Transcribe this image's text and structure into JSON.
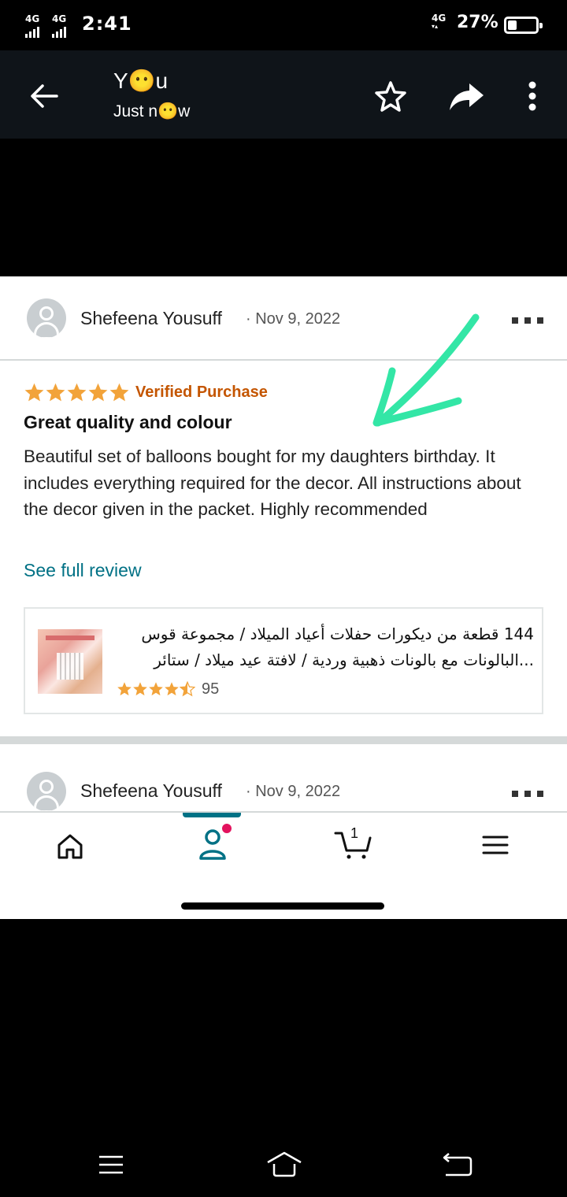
{
  "status_bar": {
    "net1": "4G",
    "net2": "4G",
    "time": "2:41",
    "net_right": "4G",
    "battery_pct": "27%",
    "battery_level": 0.27
  },
  "toolbar": {
    "title": "Y😶u",
    "subtitle": "Just n😶w"
  },
  "review1": {
    "reviewer": "Shefeena Yousuff",
    "date": "· Nov 9, 2022",
    "rating": 5,
    "verified": "Verified Purchase",
    "title": "Great quality and colour",
    "body": "Beautiful set of balloons bought for my daughters birthday. It includes everything required for the decor. All instructions about the decor given in the packet. Highly recommended",
    "see_full": "See full review",
    "product": {
      "title_line1": "144 قطعة من ديكورات حفلات أعياد الميلاد / مجموعة قوس",
      "title_line2": "...البالونات مع بالونات ذهبية وردية / لافتة عيد ميلاد / ستائر",
      "rating": 4.5,
      "count": "95"
    }
  },
  "review2": {
    "reviewer": "Shefeena Yousuff",
    "date": "· Nov 9, 2022"
  },
  "bottom_nav": {
    "cart_count": "1"
  },
  "colors": {
    "accent_teal": "#007185",
    "star_orange": "#f2a33a",
    "verified_orange": "#c45500",
    "notification_pink": "#e3135e",
    "annotation_green": "#33e6a6"
  }
}
